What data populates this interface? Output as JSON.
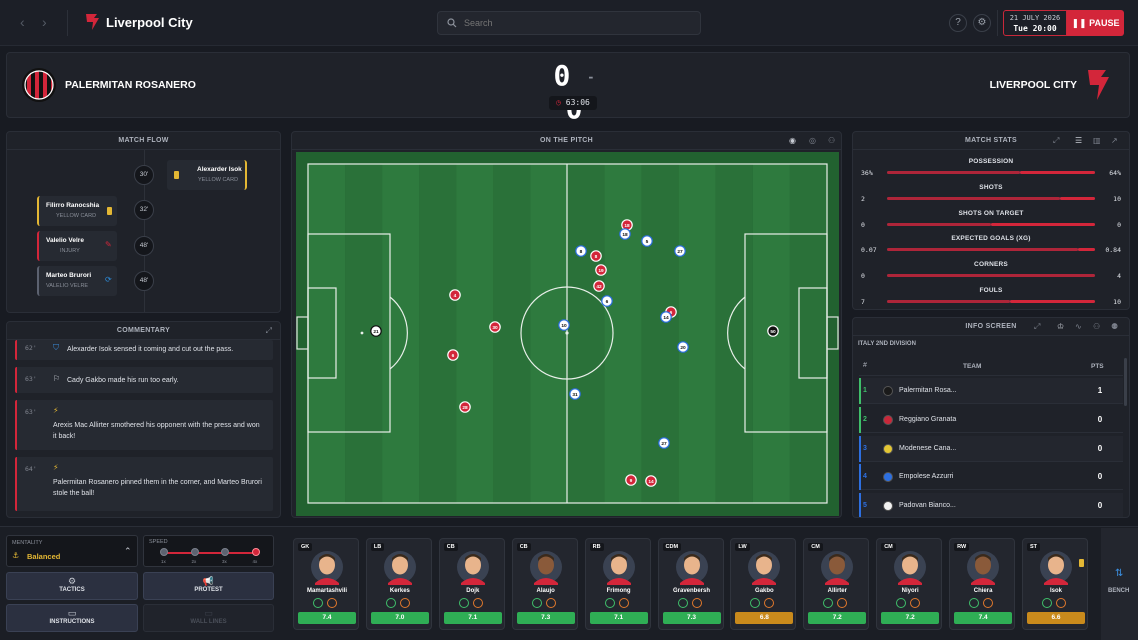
{
  "header": {
    "club_name": "Liverpool City",
    "search_placeholder": "Search",
    "date": "21 JULY 2026",
    "time": "Tue 20:00",
    "pause_label": "PAUSE"
  },
  "scoreboard": {
    "home_team": "PALERMITAN ROSANERO",
    "away_team": "LIVERPOOL CITY",
    "home_score": "0",
    "away_score": "0",
    "separator": "-",
    "clock": "63:06",
    "colors": {
      "home": "#d3263a",
      "away": "#d3263a"
    }
  },
  "match_flow": {
    "title": "MATCH FLOW",
    "events": [
      {
        "minute": "30'",
        "side": "away",
        "player": "Alexarder Isok",
        "type": "YELLOW CARD",
        "icon": "yellow-card-icon"
      },
      {
        "minute": "32'",
        "side": "home",
        "player": "Filirro Ranocshia",
        "type": "YELLOW CARD",
        "icon": "yellow-card-icon"
      },
      {
        "minute": "48'",
        "side": "home",
        "player": "Valelio Velre",
        "type": "INJURY",
        "icon": "injury-icon"
      },
      {
        "minute": "48'",
        "side": "home",
        "player": "Marteo Brurori",
        "type": "VALELIO VELRE",
        "icon": "substitution-icon"
      }
    ]
  },
  "commentary": {
    "title": "COMMENTARY",
    "items": [
      {
        "minute": "62'",
        "text": "Alexarder Isok sensed it coming and cut out the pass.",
        "icon": "shield-icon"
      },
      {
        "minute": "63'",
        "text": "Cady Gakbo made his run too early.",
        "icon": "flag-icon"
      },
      {
        "minute": "63'",
        "text": "Arexis Mac Allirter smothered his opponent with the press and won it back!",
        "icon": "lightning-icon"
      },
      {
        "minute": "64'",
        "text": "Palermitan Rosanero pinned them in the corner, and Marteo Brurori stole the ball!",
        "icon": "lightning-icon"
      }
    ]
  },
  "pitch": {
    "title": "ON THE PITCH",
    "colors": {
      "grass_light": "#2e7a3e",
      "grass_dark": "#2a7139",
      "home": "#d3263a",
      "away": "#2d6fe0"
    },
    "home_players": [
      {
        "n": "4"
      },
      {
        "n": "6"
      },
      {
        "n": "30"
      },
      {
        "n": "28"
      },
      {
        "n": "18"
      },
      {
        "n": "42"
      },
      {
        "n": "8"
      },
      {
        "n": "14"
      },
      {
        "n": "19"
      },
      {
        "n": "6"
      },
      {
        "n": "9"
      }
    ],
    "away_players": [
      {
        "n": "10"
      },
      {
        "n": "18"
      },
      {
        "n": "8"
      },
      {
        "n": "5"
      },
      {
        "n": "27"
      },
      {
        "n": "6"
      },
      {
        "n": "14"
      },
      {
        "n": "20"
      },
      {
        "n": "31"
      },
      {
        "n": "27"
      }
    ],
    "goalkeepers": [
      {
        "n": "21"
      },
      {
        "n": "50"
      }
    ]
  },
  "match_stats": {
    "title": "MATCH STATS",
    "rows": [
      {
        "label": "POSSESSION",
        "home": "36%",
        "away": "64%",
        "home_share": 0.36
      },
      {
        "label": "SHOTS",
        "home": "2",
        "away": "10",
        "home_share": 0.17
      },
      {
        "label": "SHOTS ON TARGET",
        "home": "0",
        "away": "0",
        "home_share": 0.5
      },
      {
        "label": "EXPECTED GOALS (XG)",
        "home": "0.07",
        "away": "0.84",
        "home_share": 0.08
      },
      {
        "label": "CORNERS",
        "home": "0",
        "away": "4",
        "home_share": 0.0
      },
      {
        "label": "FOULS",
        "home": "7",
        "away": "10",
        "home_share": 0.41
      }
    ]
  },
  "info_screen": {
    "title": "INFO SCREEN",
    "league": "ITALY 2ND DIVISION",
    "col_pos": "#",
    "col_team": "TEAM",
    "col_pts": "PTS",
    "rows": [
      {
        "pos": "1",
        "team": "Palermitan Rosa...",
        "pts": "1",
        "badge": "#1a1a1a",
        "bar": "#3fbf6a"
      },
      {
        "pos": "2",
        "team": "Reggiano Granata",
        "pts": "0",
        "badge": "#c8283a",
        "bar": "#3fbf6a"
      },
      {
        "pos": "3",
        "team": "Modenese Cana...",
        "pts": "0",
        "badge": "#e3c634",
        "bar": "#2d6fe0"
      },
      {
        "pos": "4",
        "team": "Empolese Azzurri",
        "pts": "0",
        "badge": "#2d6fe0",
        "bar": "#2d6fe0"
      },
      {
        "pos": "5",
        "team": "Padovan Bianco...",
        "pts": "0",
        "badge": "#f2f2f2",
        "bar": "#2d6fe0"
      }
    ]
  },
  "controls": {
    "mentality_label": "MENTALITY",
    "mentality_value": "Balanced",
    "speed_label": "SPEED",
    "speed_steps": [
      "1x",
      "2x",
      "3x",
      "4x"
    ],
    "speed_selected": 3,
    "tactics_label": "TACTICS",
    "protest_label": "PROTEST",
    "instructions_label": "INSTRUCTIONS",
    "disabled_label": "WALL LINES",
    "bench_label": "BENCH"
  },
  "lineup": [
    {
      "pos": "GK",
      "name": "Mamartashvili",
      "rating": "7.4",
      "rating_color": "#2fae55"
    },
    {
      "pos": "LB",
      "name": "Kerkes",
      "rating": "7.0",
      "rating_color": "#2fae55"
    },
    {
      "pos": "CB",
      "name": "Dojk",
      "rating": "7.1",
      "rating_color": "#2fae55"
    },
    {
      "pos": "CB",
      "name": "Alaujo",
      "rating": "7.3",
      "rating_color": "#2fae55"
    },
    {
      "pos": "RB",
      "name": "Frimong",
      "rating": "7.1",
      "rating_color": "#2fae55"
    },
    {
      "pos": "CDM",
      "name": "Gravenbersh",
      "rating": "7.3",
      "rating_color": "#2fae55"
    },
    {
      "pos": "LW",
      "name": "Gakbo",
      "rating": "6.8",
      "rating_color": "#c98a1c"
    },
    {
      "pos": "CM",
      "name": "Allirter",
      "rating": "7.2",
      "rating_color": "#2fae55"
    },
    {
      "pos": "CM",
      "name": "Niyori",
      "rating": "7.2",
      "rating_color": "#2fae55"
    },
    {
      "pos": "RW",
      "name": "Chiera",
      "rating": "7.4",
      "rating_color": "#2fae55"
    },
    {
      "pos": "ST",
      "name": "Isok",
      "rating": "6.6",
      "rating_color": "#c98a1c"
    }
  ]
}
